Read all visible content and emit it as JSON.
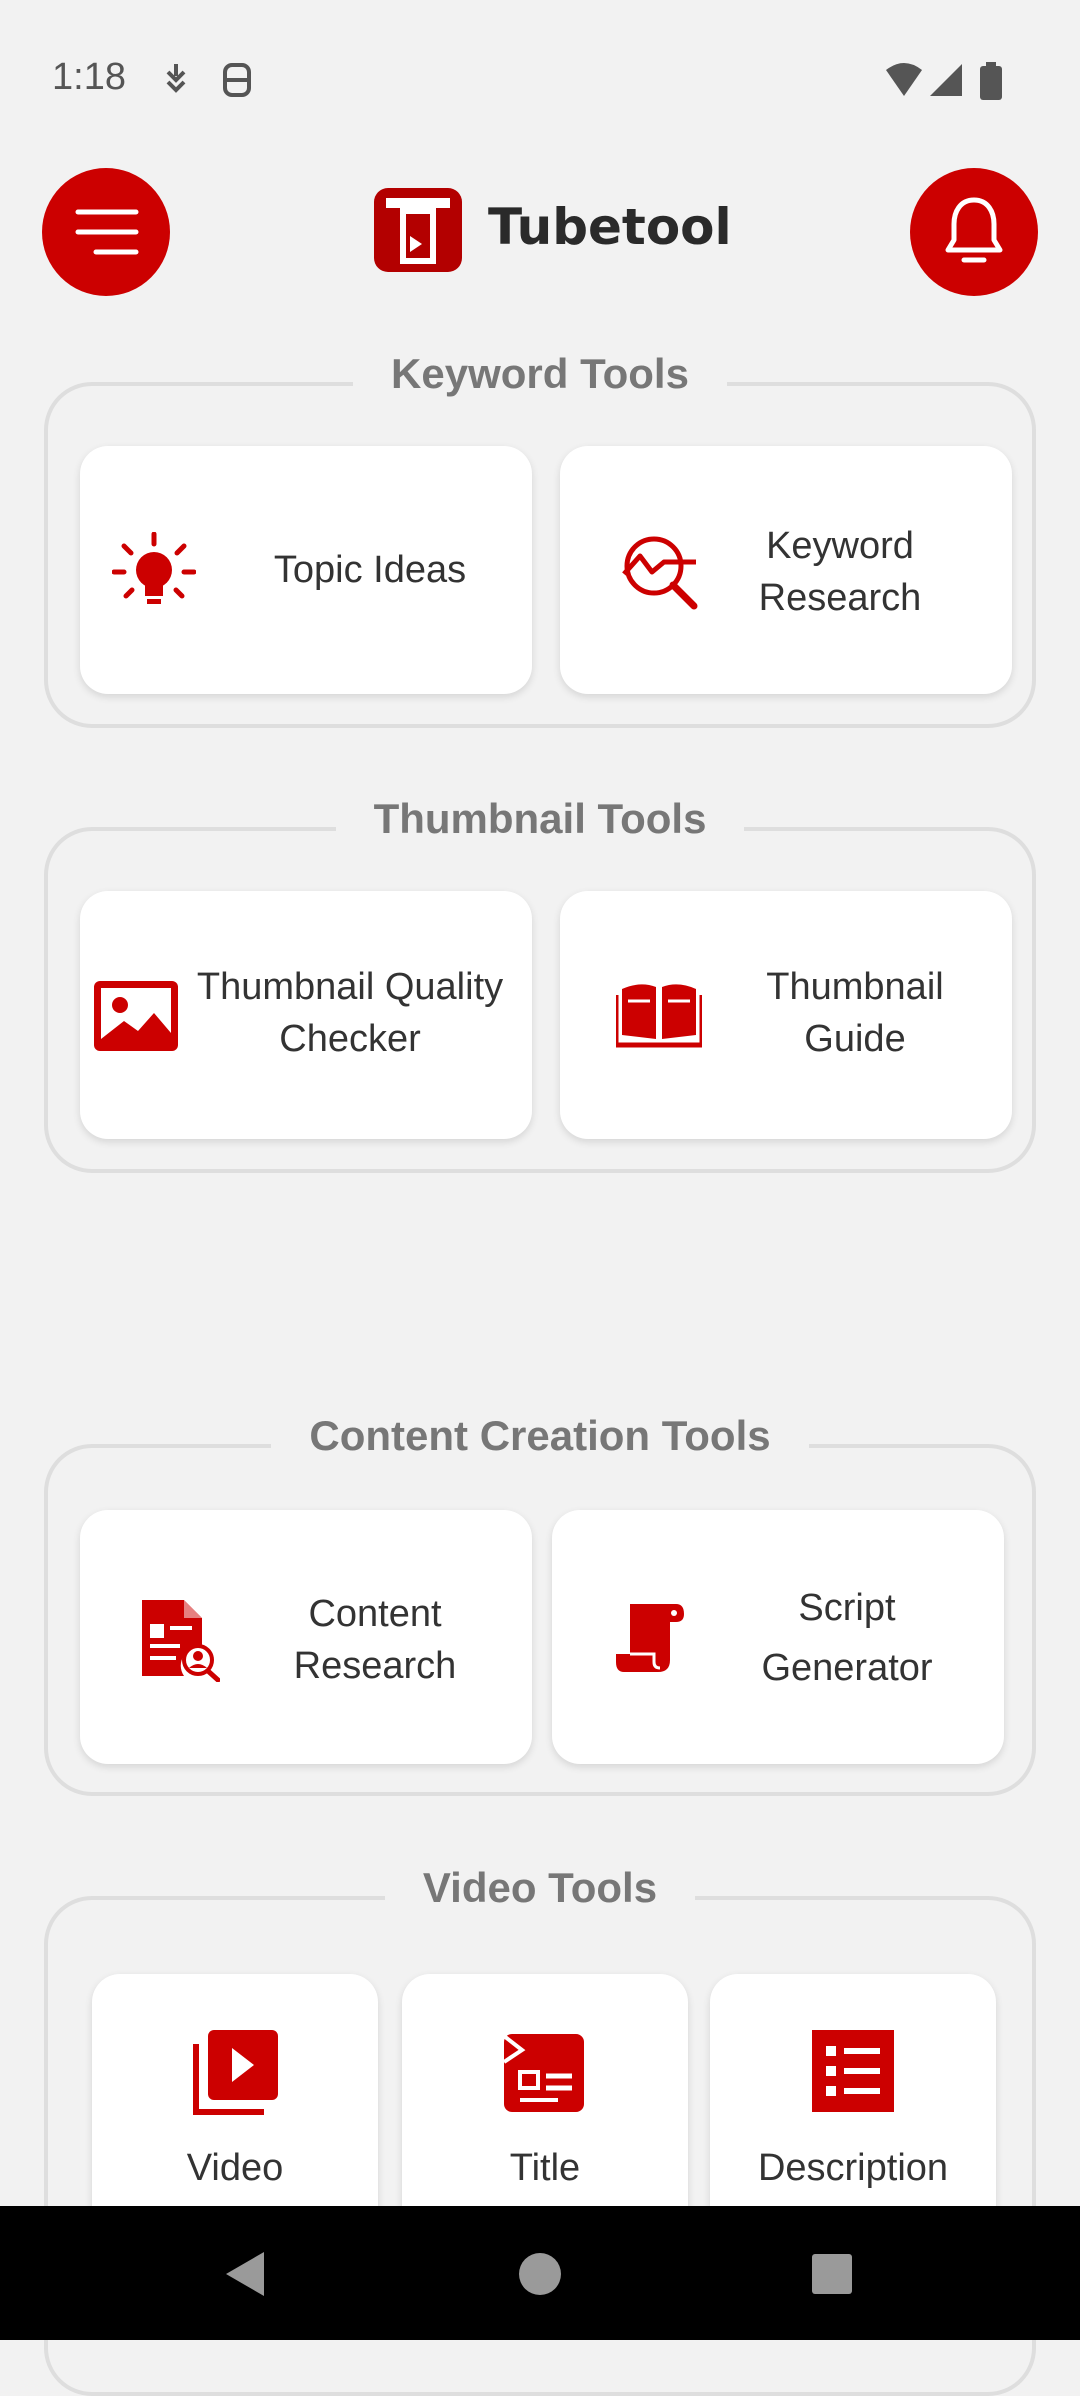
{
  "status_bar": {
    "time": "1:18"
  },
  "header": {
    "app_title": "Tubetool"
  },
  "sections": {
    "keyword": {
      "title": "Keyword Tools",
      "cards": {
        "topic": {
          "label": "Topic Ideas"
        },
        "keyword": {
          "line1": "Keyword",
          "line2": "Research"
        }
      }
    },
    "thumbnail": {
      "title": "Thumbnail Tools",
      "cards": {
        "quality": {
          "line1": "Thumbnail Quality",
          "line2": "Checker"
        },
        "guide": {
          "line1": "Thumbnail",
          "line2": "Guide"
        }
      }
    },
    "content": {
      "title": "Content Creation Tools",
      "cards": {
        "research": {
          "line1": "Content",
          "line2": "Research"
        },
        "script": {
          "line1": "Script",
          "line2": "Generator"
        }
      }
    },
    "video": {
      "title": "Video Tools",
      "cards": {
        "video": {
          "label": "Video"
        },
        "title": {
          "label": "Title"
        },
        "description": {
          "label": "Description"
        }
      }
    }
  },
  "colors": {
    "accent": "#cc0000",
    "background": "#f2f2f2"
  },
  "icons": [
    "hamburger-menu-icon",
    "bell-icon",
    "lightbulb-icon",
    "chart-search-icon",
    "image-icon",
    "open-book-icon",
    "document-user-icon",
    "scroll-icon",
    "video-library-icon",
    "title-card-icon",
    "list-icon"
  ]
}
